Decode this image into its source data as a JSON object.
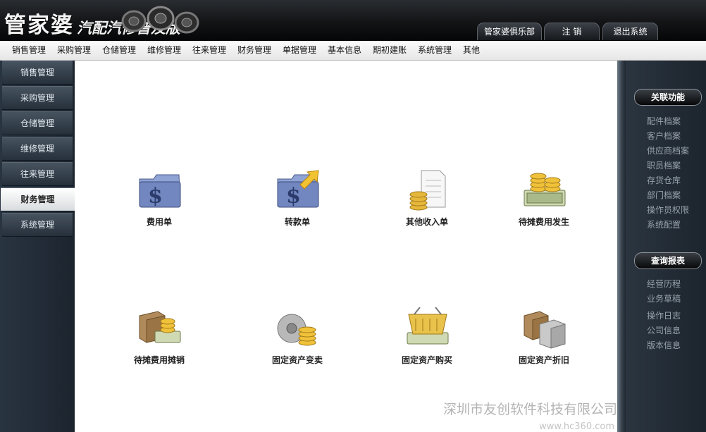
{
  "header": {
    "logo_main": "管家婆",
    "logo_sub": "汽配汽修普及版",
    "buttons": [
      "管家婆俱乐部",
      "注  销",
      "退出系统"
    ]
  },
  "menu": [
    "销售管理",
    "采购管理",
    "仓储管理",
    "维修管理",
    "往来管理",
    "财务管理",
    "单据管理",
    "基本信息",
    "期初建账",
    "系统管理",
    "其他"
  ],
  "sidebar": {
    "items": [
      "销售管理",
      "采购管理",
      "仓储管理",
      "维修管理",
      "往来管理",
      "财务管理",
      "系统管理"
    ],
    "active": "财务管理"
  },
  "main": {
    "tiles": [
      {
        "label": "费用单",
        "icon": "dollar-folder-icon"
      },
      {
        "label": "转款单",
        "icon": "dollar-folder-arrow-icon"
      },
      {
        "label": "其他收入单",
        "icon": "document-coins-icon"
      },
      {
        "label": "待摊费用发生",
        "icon": "cash-coins-icon"
      },
      {
        "label": "待摊费用摊销",
        "icon": "box-cash-icon"
      },
      {
        "label": "固定资产变卖",
        "icon": "disc-coins-icon"
      },
      {
        "label": "固定资产购买",
        "icon": "basket-cash-icon"
      },
      {
        "label": "固定资产折旧",
        "icon": "boxes-icon"
      }
    ],
    "watermark": "深圳市友创软件科技有限公司",
    "watermark_url": "www.hc360.com"
  },
  "right_panel": {
    "related_title": "关联功能",
    "related_links": [
      "配件档案",
      "客户档案",
      "供应商档案",
      "职员档案",
      "存货仓库",
      "部门档案",
      "操作员权限",
      "系统配置"
    ],
    "reports_title": "查询报表",
    "report_links": [
      "经营历程",
      "业务草稿",
      "操作日志",
      "公司信息",
      "版本信息"
    ]
  },
  "colors": {
    "sidebar_bg": "#232d38",
    "header_bg": "#0b0c0d",
    "accent_gold": "#e8b820",
    "folder_blue": "#6f86c0"
  }
}
